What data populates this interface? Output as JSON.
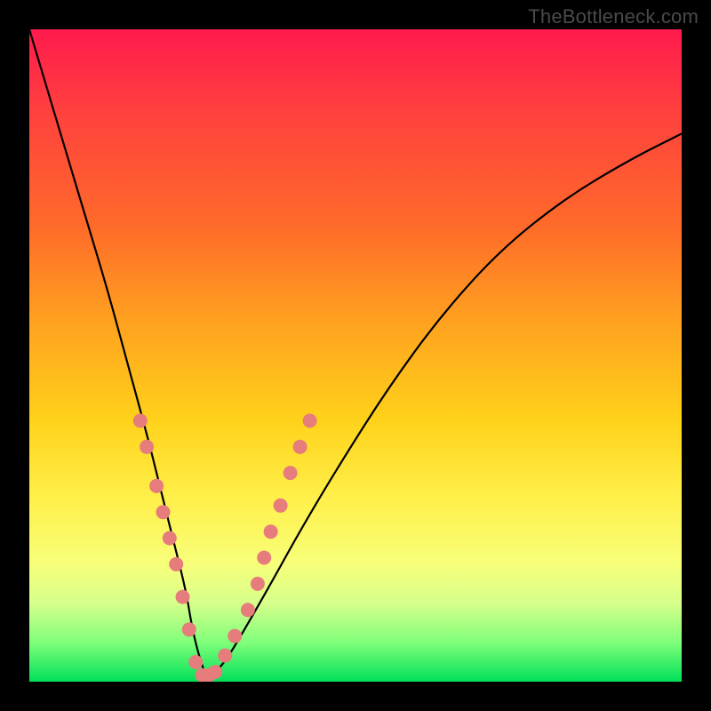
{
  "watermark": "TheBottleneck.com",
  "chart_data": {
    "type": "line",
    "title": "",
    "xlabel": "",
    "ylabel": "",
    "xlim": [
      0,
      100
    ],
    "ylim": [
      0,
      100
    ],
    "series": [
      {
        "name": "curve",
        "x": [
          0,
          3,
          6,
          9,
          12,
          15,
          18,
          20,
          22,
          24,
          25,
          26,
          27,
          28,
          30,
          33,
          37,
          42,
          48,
          55,
          63,
          72,
          82,
          92,
          100
        ],
        "y": [
          100,
          90,
          80,
          70,
          60,
          49,
          38,
          30,
          22,
          14,
          8,
          4,
          1,
          1,
          3,
          8,
          15,
          24,
          34,
          45,
          56,
          66,
          74,
          80,
          84
        ]
      }
    ],
    "markers": {
      "name": "highlight-dots",
      "color": "#e77c7c",
      "radius_px": 8,
      "points_xy": [
        [
          17,
          40
        ],
        [
          18,
          36
        ],
        [
          19.5,
          30
        ],
        [
          20.5,
          26
        ],
        [
          21.5,
          22
        ],
        [
          22.5,
          18
        ],
        [
          23.5,
          13
        ],
        [
          24.5,
          8
        ],
        [
          25.5,
          3
        ],
        [
          26.5,
          1
        ],
        [
          27.5,
          1
        ],
        [
          28.5,
          1.5
        ],
        [
          30,
          4
        ],
        [
          31.5,
          7
        ],
        [
          33.5,
          11
        ],
        [
          35,
          15
        ],
        [
          36,
          19
        ],
        [
          37,
          23
        ],
        [
          38.5,
          27
        ],
        [
          40,
          32
        ],
        [
          41.5,
          36
        ],
        [
          43,
          40
        ]
      ]
    }
  }
}
